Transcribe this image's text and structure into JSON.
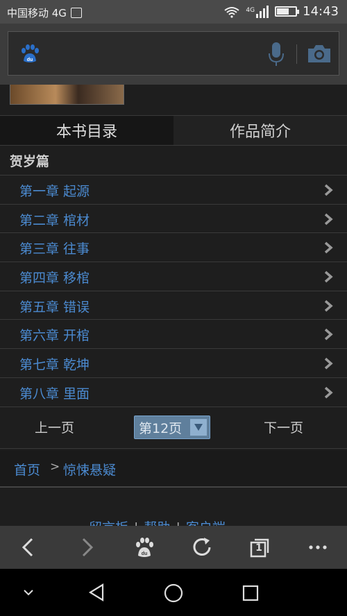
{
  "status_bar": {
    "carrier": "中国移动 4G",
    "network": "4G",
    "time": "14:43"
  },
  "tabs": [
    {
      "label": "本书目录",
      "active": true
    },
    {
      "label": "作品简介",
      "active": false
    }
  ],
  "section_title": "贺岁篇",
  "chapters": [
    "第一章 起源",
    "第二章 棺材",
    "第三章 往事",
    "第四章 移棺",
    "第五章 错误",
    "第六章 开棺",
    "第七章 乾坤",
    "第八章 里面"
  ],
  "pager": {
    "prev": "上一页",
    "current_page": "第12页",
    "next": "下一页"
  },
  "breadcrumb": {
    "home": "首页",
    "separator": ">",
    "current": "惊悚悬疑"
  },
  "footer_links": [
    "留言板",
    "帮助",
    "客户端"
  ],
  "colors": {
    "link": "#4b8ad0",
    "accent_blue": "#2a6fc9"
  },
  "icons": {
    "search_logo": "baidu-paw-icon",
    "voice": "microphone-icon",
    "camera": "camera-icon",
    "back": "chevron-left-icon",
    "forward": "chevron-right-icon",
    "home": "baidu-paw-icon",
    "refresh": "refresh-icon",
    "tabs": "tabs-icon",
    "menu": "more-icon"
  },
  "tab_count": "1"
}
